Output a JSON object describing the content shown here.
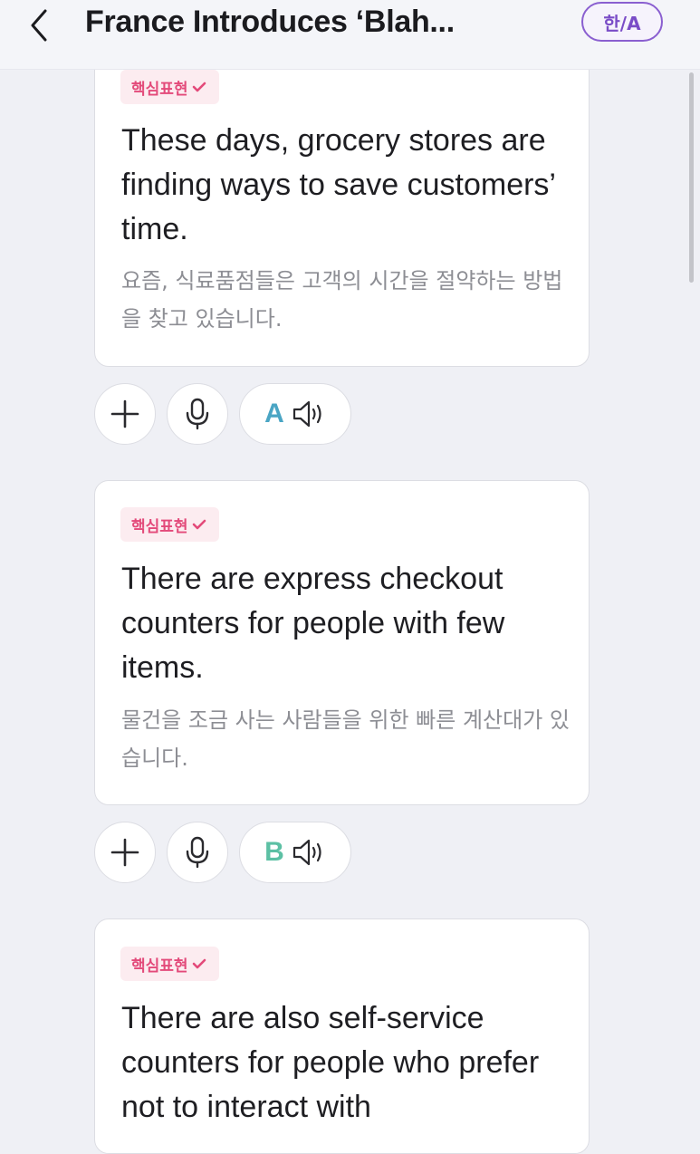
{
  "header": {
    "title": "France Introduces ‘Blah...",
    "lang_toggle_label": "한/A"
  },
  "cards": [
    {
      "tag": "핵심표현",
      "sentence": "These days, grocery stores are finding ways to save customers’ time.",
      "translation": "요즘, 식료품점들은 고객의 시간을 절약하는 방법을 찾고 있습니다.",
      "speaker": "A",
      "speaker_color": "#4aa5c4"
    },
    {
      "tag": "핵심표현",
      "sentence": "There are express checkout counters for people with few items.",
      "translation": "물건을 조금 사는 사람들을 위한 빠른 계산대가 있습니다.",
      "speaker": "B",
      "speaker_color": "#5cc0a4"
    },
    {
      "tag": "핵심표현",
      "sentence": "There are also self-service counters for people who prefer not to interact with",
      "translation": "",
      "speaker": "",
      "speaker_color": ""
    }
  ],
  "colors": {
    "accent_purple": "#7a4cc7",
    "tag_pink": "#e34a7a",
    "tag_background": "#fcecf0",
    "page_background": "#eff0f5"
  },
  "icons": [
    "chevron-left-icon",
    "plus-icon",
    "microphone-icon",
    "speaker-icon",
    "checkmark-icon"
  ]
}
